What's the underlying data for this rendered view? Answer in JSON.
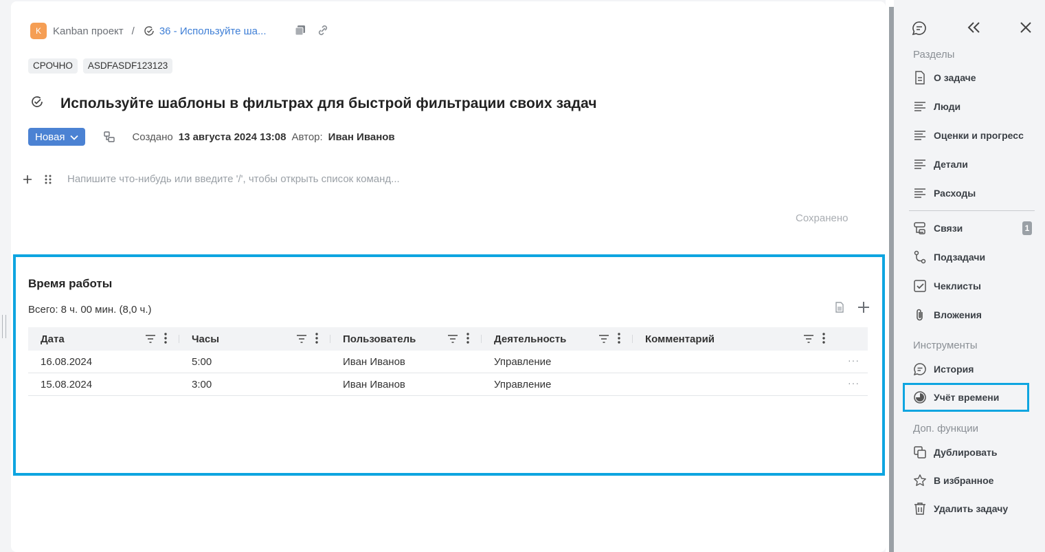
{
  "breadcrumb": {
    "project_initial": "K",
    "project": "Kanban проект",
    "separator": "/",
    "task": "36 -  Используйте ша..."
  },
  "tags": [
    "СРОЧНО",
    "ASDFASDF123123"
  ],
  "title": "Используйте шаблоны в фильтрах для быстрой фильтрации своих задач",
  "meta": {
    "status": "Новая",
    "created_label": "Создано",
    "created_value": "13 августа 2024 13:08",
    "author_label": "Автор:",
    "author_value": "Иван Иванов"
  },
  "editor": {
    "placeholder": "Напишите что-нибудь или введите '/', чтобы открыть список команд...",
    "saved": "Сохранено"
  },
  "time_tracking": {
    "title": "Время работы",
    "total": "Всего: 8 ч. 00 мин. (8,0 ч.)",
    "columns": [
      "Дата",
      "Часы",
      "Пользователь",
      "Деятельность",
      "Комментарий"
    ],
    "rows": [
      [
        "16.08.2024",
        "5:00",
        "Иван Иванов",
        "Управление",
        ""
      ],
      [
        "15.08.2024",
        "3:00",
        "Иван Иванов",
        "Управление",
        ""
      ]
    ],
    "row_menu": "···"
  },
  "sidebar": {
    "sections_title": "Разделы",
    "sections": [
      {
        "label": "О задаче",
        "icon": "document-icon"
      },
      {
        "label": "Люди",
        "icon": "lines-icon"
      },
      {
        "label": "Оценки и прогресс",
        "icon": "lines-icon"
      },
      {
        "label": "Детали",
        "icon": "lines-icon"
      },
      {
        "label": "Расходы",
        "icon": "lines-icon"
      }
    ],
    "links": [
      {
        "label": "Связи",
        "icon": "links-icon",
        "count": "1"
      },
      {
        "label": "Подзадачи",
        "icon": "subtasks-icon"
      },
      {
        "label": "Чеклисты",
        "icon": "checklist-icon"
      },
      {
        "label": "Вложения",
        "icon": "paperclip-icon"
      }
    ],
    "tools_title": "Инструменты",
    "tools": [
      {
        "label": "История",
        "icon": "chat-icon"
      },
      {
        "label": "Учёт времени",
        "icon": "timer-icon"
      }
    ],
    "extra_title": "Доп. функции",
    "extra": [
      {
        "label": "Дублировать",
        "icon": "duplicate-icon"
      },
      {
        "label": "В избранное",
        "icon": "star-icon"
      },
      {
        "label": "Удалить задачу",
        "icon": "trash-icon"
      }
    ]
  },
  "colors": {
    "accent": "#4b82d3",
    "highlight": "#0ea5e0",
    "project_badge": "#f59e54",
    "link": "#3f7fd6"
  }
}
